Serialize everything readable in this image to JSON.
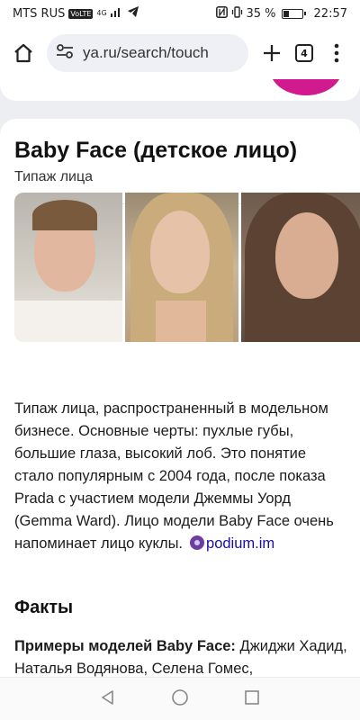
{
  "status_bar": {
    "carrier": "MTS RUS",
    "volte": "VoLTE",
    "network": "4G",
    "battery_percent": "35 %",
    "battery_level": 0.35,
    "time": "22:57"
  },
  "toolbar": {
    "url": "ya.ru/search/touch",
    "tabs_count": "4"
  },
  "card": {
    "title": "Baby Face (детское лицо)",
    "subtitle": "Типаж лица",
    "photos": [
      "photo-1",
      "photo-2",
      "photo-3"
    ],
    "description": "Типаж лица, распространенный в модельном бизнесе. Основные черты: пухлые губы, большие глаза, высокий лоб. Это понятие стало популярным с 2004 года, после показа Prada с участием модели Джеммы Уорд (Gemma Ward). Лицо модели Baby Face очень напоминает лицо куклы.",
    "source": "podium.im",
    "facts_heading": "Факты",
    "facts_label": "Примеры моделей Baby Face:",
    "facts_value": "Джиджи Хадид, Наталья Водянова, Селена Гомес,"
  },
  "colors": {
    "accent_magenta": "#d01a8e",
    "link": "#1a0dab",
    "urlbar": "#eef0f6"
  }
}
